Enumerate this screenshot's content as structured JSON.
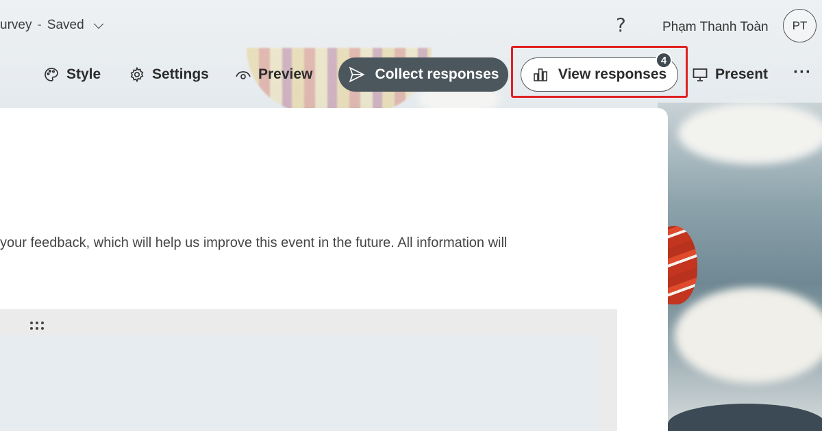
{
  "header": {
    "form_title": "urvey",
    "separator": "-",
    "save_status": "Saved",
    "help_symbol": "?",
    "user_name": "Phạm Thanh Toàn",
    "user_initials": "PT"
  },
  "toolbar": {
    "style_label": "Style",
    "settings_label": "Settings",
    "preview_label": "Preview",
    "collect_label": "Collect responses",
    "view_label": "View responses",
    "response_count": "4",
    "present_label": "Present",
    "more_label": "···"
  },
  "card": {
    "description": "your feedback, which will help us improve this event in the future. All information will"
  },
  "icons": [
    "chevron-down-icon",
    "palette-icon",
    "gear-icon",
    "eye-icon",
    "send-icon",
    "bar-chart-icon",
    "monitor-icon",
    "more-icon",
    "drag-handle-icon"
  ],
  "colors": {
    "collect_bg": "#4b575c",
    "highlight": "#e02020",
    "badge_bg": "#3e4a50"
  }
}
